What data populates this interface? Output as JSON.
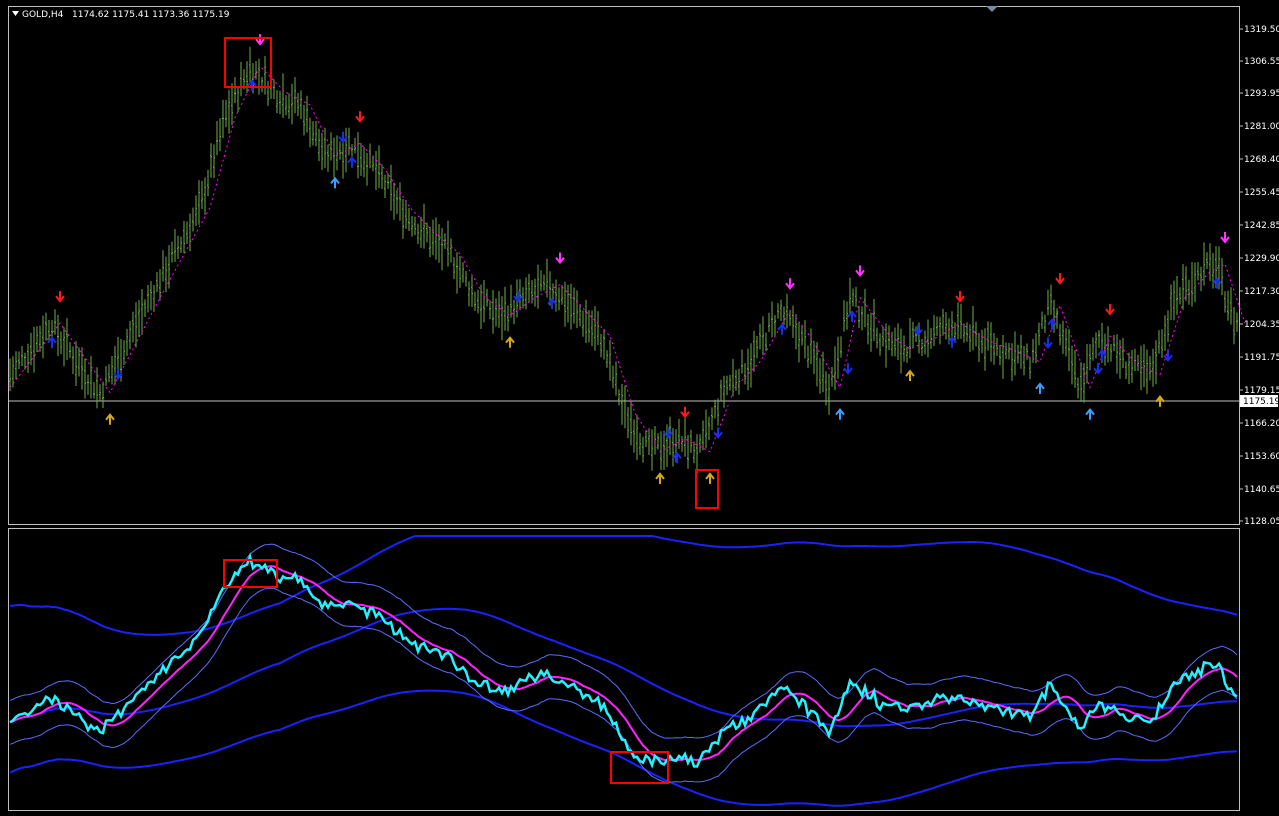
{
  "header": {
    "symbol": "GOLD,H4",
    "ohlc": "1174.62 1175.41 1173.36 1175.19"
  },
  "price_axis": {
    "ticks": [
      "1319.50",
      "1306.55",
      "1293.95",
      "1281.00",
      "1268.40",
      "1255.45",
      "1242.85",
      "1229.90",
      "1217.30",
      "1204.35",
      "1191.75",
      "1179.15",
      "1166.20",
      "1153.60",
      "1140.65",
      "1128.05"
    ],
    "current_price_label": "1175.19",
    "current_price": 1175.19
  },
  "colors": {
    "background": "#000000",
    "frame": "#c0c0c0",
    "bars": "#6fae4a",
    "price_line": "#ff00ff",
    "arrow_red": "#ff1a1a",
    "arrow_magenta": "#ff33ff",
    "arrow_blue": "#1530e6",
    "arrow_gold": "#d4aa1a",
    "arrow_lightblue": "#3aa0ff",
    "osc_main": "#26f2ff",
    "osc_signal": "#ff22ff",
    "band_outer": "#1a22ff",
    "band_inner": "#5a6cff",
    "highlight_box": "#ff0000"
  },
  "chart_data": {
    "type": "line",
    "title": "GOLD,H4",
    "ylim": [
      1128.05,
      1319.5
    ],
    "x": [
      0,
      50,
      100,
      150,
      200,
      225,
      250,
      275,
      300,
      325,
      350,
      375,
      400,
      425,
      450,
      475,
      500,
      525,
      550,
      575,
      600,
      625,
      650,
      675,
      700,
      725,
      750,
      780,
      800,
      830,
      850,
      880,
      900,
      930,
      950,
      980,
      1000,
      1030,
      1050,
      1080,
      1100,
      1130,
      1150,
      1175,
      1200,
      1215,
      1235
    ],
    "series": [
      {
        "values": [
          1180,
          1205,
          1178,
          1215,
          1250,
          1285,
          1305,
          1295,
          1290,
          1270,
          1275,
          1265,
          1250,
          1240,
          1232,
          1215,
          1208,
          1215,
          1220,
          1210,
          1200,
          1170,
          1155,
          1160,
          1155,
          1180,
          1190,
          1210,
          1200,
          1180,
          1215,
          1200,
          1195,
          1200,
          1205,
          1198,
          1195,
          1190,
          1212,
          1180,
          1200,
          1188,
          1185,
          1215,
          1225,
          1228,
          1205
        ]
      }
    ]
  }
}
